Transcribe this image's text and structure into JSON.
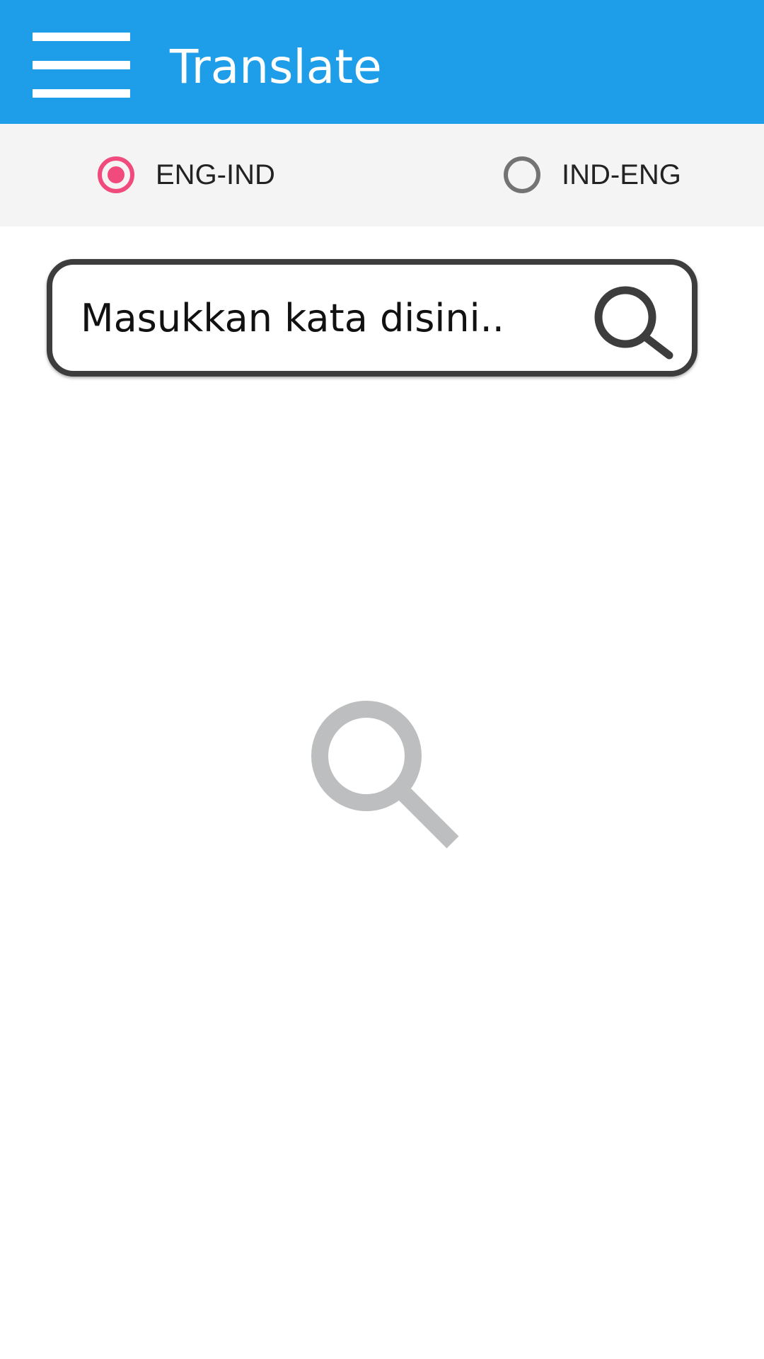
{
  "appbar": {
    "title": "Translate",
    "color": "#1e9ee8",
    "menu_icon": "hamburger-menu-icon"
  },
  "direction": {
    "options": [
      {
        "label": "ENG-IND",
        "checked": true
      },
      {
        "label": "IND-ENG",
        "checked": false
      }
    ],
    "accent_color": "#f14a7c"
  },
  "search": {
    "placeholder": "Masukkan kata disini..",
    "value": "",
    "button_icon": "search-icon"
  },
  "empty_state": {
    "icon": "magnifier-icon"
  }
}
